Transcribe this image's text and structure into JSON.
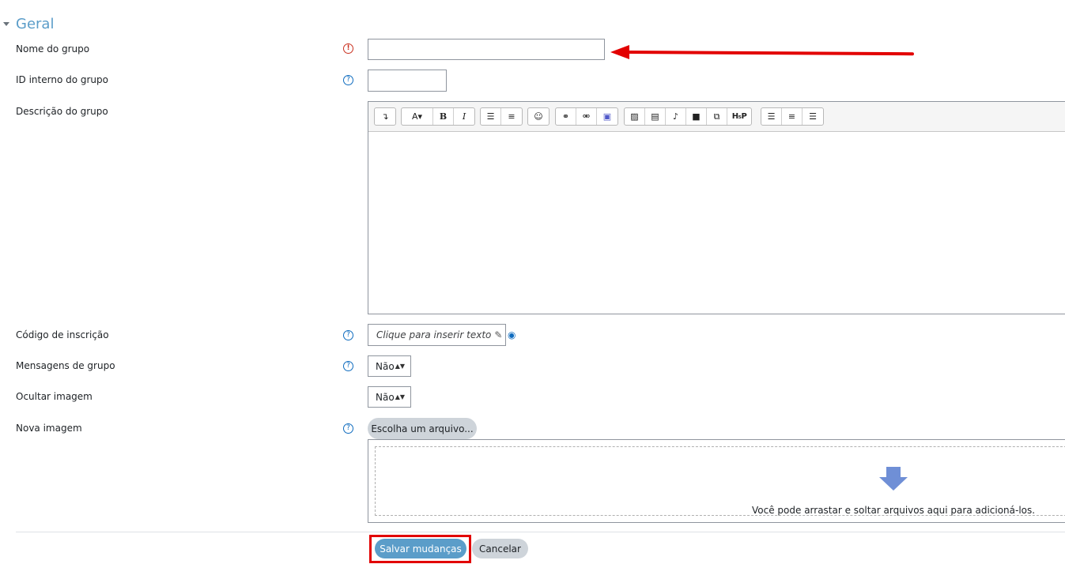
{
  "section": {
    "title": "Geral"
  },
  "fields": {
    "group_name": {
      "label": "Nome do grupo",
      "value": ""
    },
    "internal_id": {
      "label": "ID interno do grupo",
      "value": ""
    },
    "description": {
      "label": "Descrição do grupo"
    },
    "enrolment_key": {
      "label": "Código de inscrição",
      "placeholder": "Clique para inserir texto"
    },
    "group_messaging": {
      "label": "Mensagens de grupo",
      "selected": "Não"
    },
    "hide_picture": {
      "label": "Ocultar imagem",
      "selected": "Não"
    },
    "new_picture": {
      "label": "Nova imagem",
      "choose_label": "Escolha um arquivo...",
      "drop_text": "Você pode arrastar e soltar arquivos aqui para adicioná-los."
    }
  },
  "editor_toolbar": {
    "groups": [
      [
        "collapse-icon"
      ],
      [
        "font-style-icon",
        "bold-icon",
        "italic-icon"
      ],
      [
        "unordered-list-icon",
        "ordered-list-icon"
      ],
      [
        "emoji-icon"
      ],
      [
        "link-icon",
        "unlink-icon",
        "teams-icon"
      ],
      [
        "image-icon",
        "media-icon",
        "record-audio-icon",
        "record-video-icon",
        "manage-files-icon",
        "h5p-icon"
      ],
      [
        "align-left-icon",
        "align-center-icon",
        "align-right-icon"
      ]
    ],
    "h5p_label": "H₅P",
    "bold_label": "B",
    "italic_label": "I",
    "font_label": "A▾"
  },
  "actions": {
    "save": "Salvar mudanças",
    "cancel": "Cancelar"
  },
  "colors": {
    "accent": "#5b9dc9",
    "annotation": "#e20000",
    "required": "#ca3120",
    "help": "#0f6cbf"
  }
}
